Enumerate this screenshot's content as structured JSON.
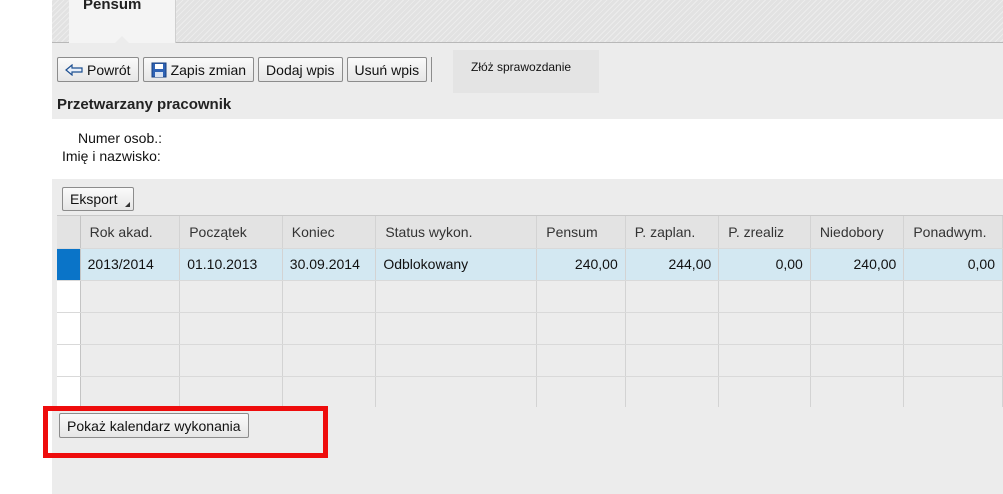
{
  "tab": {
    "label": "Pensum"
  },
  "toolbar": {
    "back_label": "Powrót",
    "save_label": "Zapis zmian",
    "add_label": "Dodaj wpis",
    "delete_label": "Usuń wpis",
    "report_label": "Złóż sprawozdanie"
  },
  "employee": {
    "section_title": "Przetwarzany pracownik",
    "number_label": "Numer osob.:",
    "name_label": "Imię i nazwisko:"
  },
  "export": {
    "label": "Eksport"
  },
  "table": {
    "columns": [
      "Rok akad.",
      "Początek",
      "Koniec",
      "Status wykon.",
      "Pensum",
      "P. zaplan.",
      "P. zrealiz",
      "Niedobory",
      "Ponadwym."
    ],
    "rows": [
      [
        "2013/2014",
        "01.10.2013",
        "30.09.2014",
        "Odblokowany",
        "240,00",
        "244,00",
        "0,00",
        "240,00",
        "0,00"
      ]
    ]
  },
  "bottom": {
    "calendar_label": "Pokaż kalendarz wykonania"
  },
  "colors": {
    "highlight": "#ee0c0c",
    "selection": "#0a74c8",
    "selected_row": "#d3e8f2"
  }
}
